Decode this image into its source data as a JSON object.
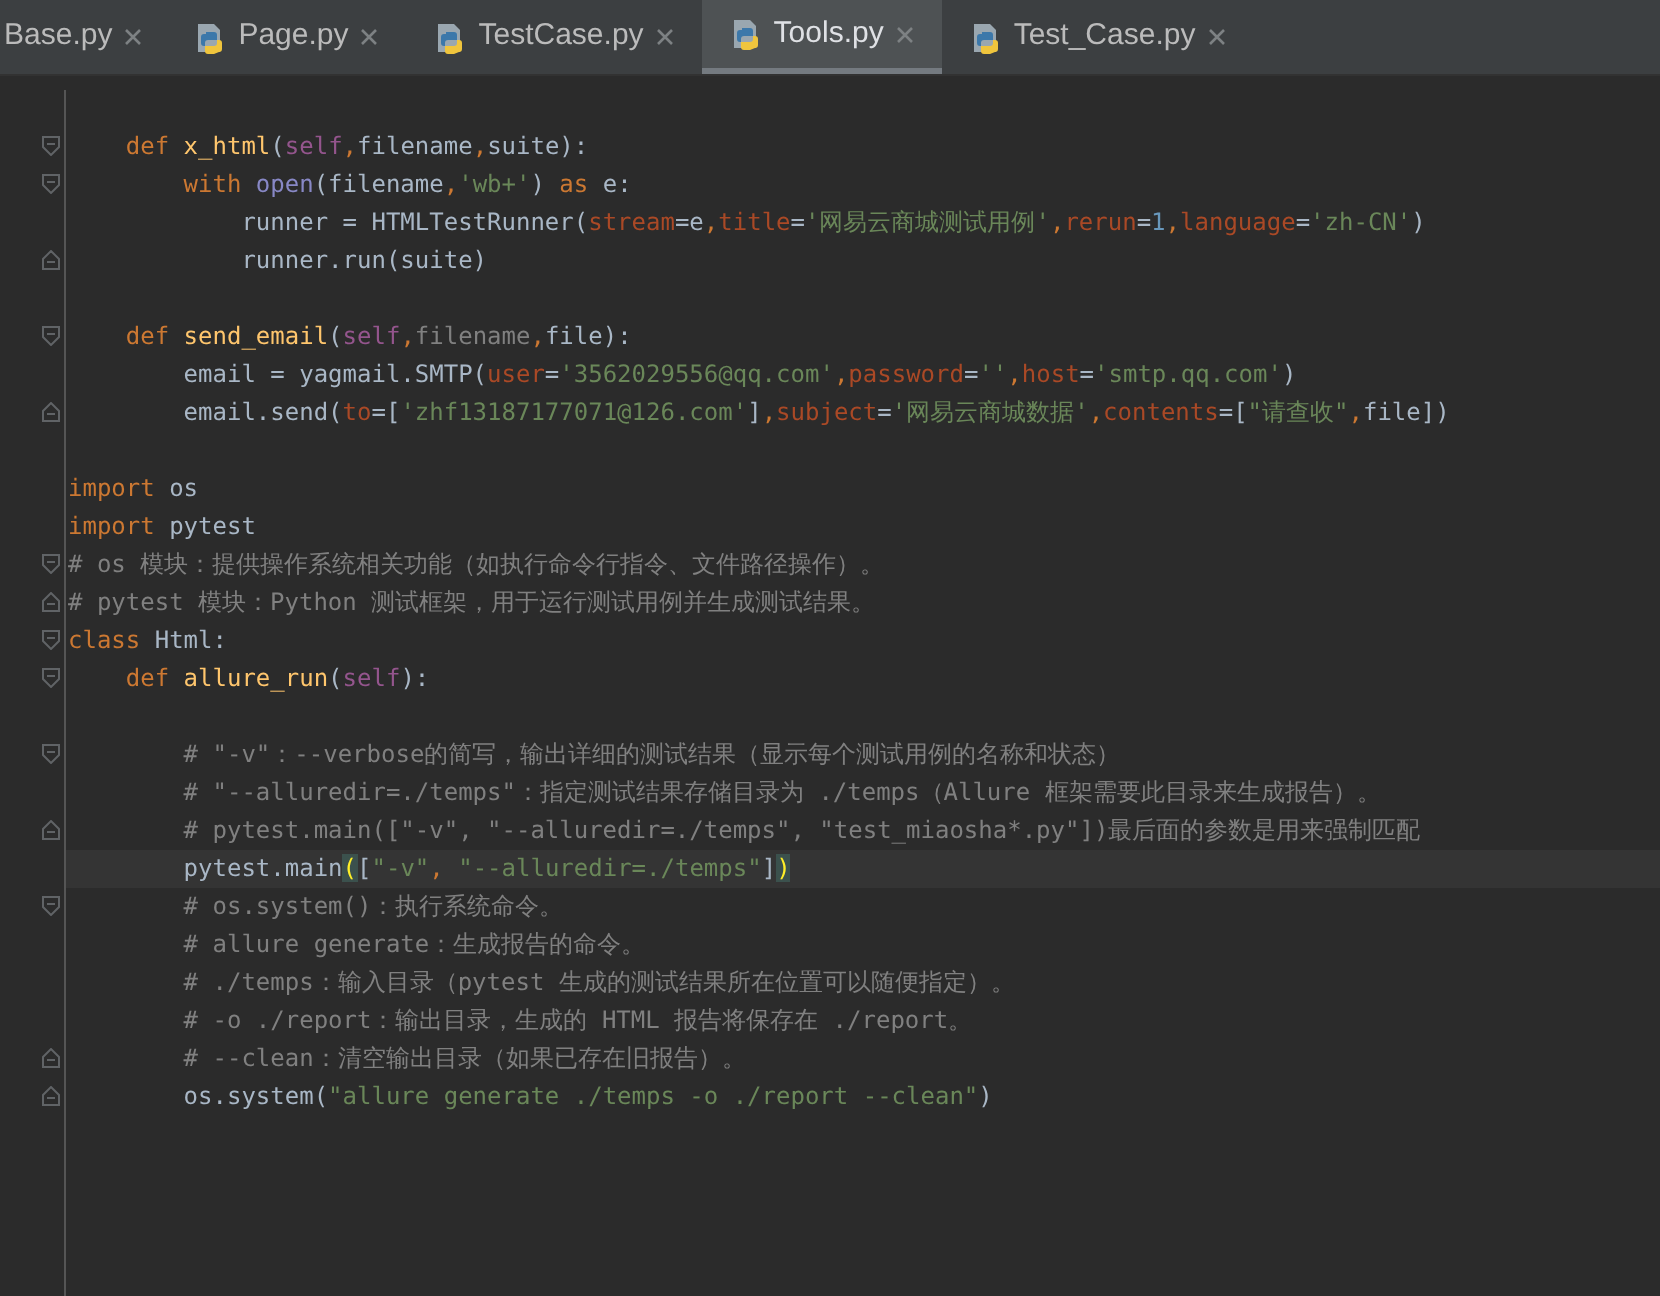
{
  "tabs": [
    {
      "label": "Base.py",
      "selected": false,
      "icon": false
    },
    {
      "label": "Page.py",
      "selected": false,
      "icon": true
    },
    {
      "label": "TestCase.py",
      "selected": false,
      "icon": true
    },
    {
      "label": "Tools.py",
      "selected": true,
      "icon": true
    },
    {
      "label": "Test_Case.py",
      "selected": false,
      "icon": true
    }
  ],
  "code_lines": [
    {
      "kind": "blank"
    },
    {
      "kind": "code",
      "fold_start": true,
      "tokens": [
        {
          "kind": "keyword",
          "text": "    def "
        },
        {
          "kind": "function",
          "text": "x_html"
        },
        {
          "kind": "plain",
          "text": "("
        },
        {
          "kind": "self",
          "text": "self"
        },
        {
          "kind": "keyword",
          "text": ","
        },
        {
          "kind": "plain",
          "text": "filename"
        },
        {
          "kind": "keyword",
          "text": ","
        },
        {
          "kind": "plain",
          "text": "suite):"
        }
      ]
    },
    {
      "kind": "code",
      "fold_start": true,
      "tokens": [
        {
          "kind": "keyword",
          "text": "        with "
        },
        {
          "kind": "builtin",
          "text": "open"
        },
        {
          "kind": "plain",
          "text": "(filename"
        },
        {
          "kind": "keyword",
          "text": ","
        },
        {
          "kind": "string",
          "text": "'wb+'"
        },
        {
          "kind": "plain",
          "text": ") "
        },
        {
          "kind": "keyword",
          "text": "as "
        },
        {
          "kind": "plain",
          "text": "e:"
        }
      ]
    },
    {
      "kind": "code",
      "tokens": [
        {
          "kind": "plain",
          "text": "            runner = HTMLTestRunner("
        },
        {
          "kind": "param",
          "text": "stream"
        },
        {
          "kind": "plain",
          "text": "=e"
        },
        {
          "kind": "keyword",
          "text": ","
        },
        {
          "kind": "param",
          "text": "title"
        },
        {
          "kind": "plain",
          "text": "="
        },
        {
          "kind": "string",
          "text": "'网易云商城测试用例'"
        },
        {
          "kind": "keyword",
          "text": ","
        },
        {
          "kind": "param",
          "text": "rerun"
        },
        {
          "kind": "plain",
          "text": "="
        },
        {
          "kind": "number",
          "text": "1"
        },
        {
          "kind": "keyword",
          "text": ","
        },
        {
          "kind": "param",
          "text": "language"
        },
        {
          "kind": "plain",
          "text": "="
        },
        {
          "kind": "string",
          "text": "'zh-CN'"
        },
        {
          "kind": "plain",
          "text": ")"
        }
      ]
    },
    {
      "kind": "code",
      "fold_end": true,
      "tokens": [
        {
          "kind": "plain",
          "text": "            runner.run(suite)"
        }
      ]
    },
    {
      "kind": "blank"
    },
    {
      "kind": "code",
      "fold_start": true,
      "tokens": [
        {
          "kind": "keyword",
          "text": "    def "
        },
        {
          "kind": "function",
          "text": "send_email"
        },
        {
          "kind": "plain",
          "text": "("
        },
        {
          "kind": "self",
          "text": "self"
        },
        {
          "kind": "keyword",
          "text": ","
        },
        {
          "kind": "comment",
          "text": "filename"
        },
        {
          "kind": "keyword",
          "text": ","
        },
        {
          "kind": "plain",
          "text": "file):"
        }
      ]
    },
    {
      "kind": "code",
      "tokens": [
        {
          "kind": "plain",
          "text": "        email = yagmail.SMTP("
        },
        {
          "kind": "param",
          "text": "user"
        },
        {
          "kind": "plain",
          "text": "="
        },
        {
          "kind": "string",
          "text": "'3562029556@qq.com'"
        },
        {
          "kind": "keyword",
          "text": ","
        },
        {
          "kind": "param",
          "text": "password"
        },
        {
          "kind": "plain",
          "text": "="
        },
        {
          "kind": "string",
          "text": "''"
        },
        {
          "kind": "keyword",
          "text": ","
        },
        {
          "kind": "param",
          "text": "host"
        },
        {
          "kind": "plain",
          "text": "="
        },
        {
          "kind": "string",
          "text": "'smtp.qq.com'"
        },
        {
          "kind": "plain",
          "text": ")"
        }
      ]
    },
    {
      "kind": "code",
      "fold_end": true,
      "tokens": [
        {
          "kind": "plain",
          "text": "        email.send("
        },
        {
          "kind": "param",
          "text": "to"
        },
        {
          "kind": "plain",
          "text": "=["
        },
        {
          "kind": "string",
          "text": "'zhf13187177071@126.com'"
        },
        {
          "kind": "plain",
          "text": "]"
        },
        {
          "kind": "keyword",
          "text": ","
        },
        {
          "kind": "param",
          "text": "subject"
        },
        {
          "kind": "plain",
          "text": "="
        },
        {
          "kind": "string",
          "text": "'网易云商城数据'"
        },
        {
          "kind": "keyword",
          "text": ","
        },
        {
          "kind": "param",
          "text": "contents"
        },
        {
          "kind": "plain",
          "text": "=["
        },
        {
          "kind": "string",
          "text": "\"请查收\""
        },
        {
          "kind": "keyword",
          "text": ","
        },
        {
          "kind": "plain",
          "text": "file])"
        }
      ]
    },
    {
      "kind": "blank"
    },
    {
      "kind": "code",
      "tokens": [
        {
          "kind": "keyword",
          "text": "import "
        },
        {
          "kind": "plain",
          "text": "os"
        }
      ]
    },
    {
      "kind": "code",
      "tokens": [
        {
          "kind": "keyword",
          "text": "import "
        },
        {
          "kind": "plain",
          "text": "pytest"
        }
      ]
    },
    {
      "kind": "code",
      "fold_start": true,
      "tokens": [
        {
          "kind": "comment",
          "text": "# os 模块：提供操作系统相关功能（如执行命令行指令、文件路径操作）。"
        }
      ]
    },
    {
      "kind": "code",
      "fold_end": true,
      "tokens": [
        {
          "kind": "comment",
          "text": "# pytest 模块：Python 测试框架，用于运行测试用例并生成测试结果。"
        }
      ]
    },
    {
      "kind": "code",
      "fold_start": true,
      "tokens": [
        {
          "kind": "keyword",
          "text": "class "
        },
        {
          "kind": "plain",
          "text": "Html:"
        }
      ]
    },
    {
      "kind": "code",
      "fold_start": true,
      "tokens": [
        {
          "kind": "keyword",
          "text": "    def "
        },
        {
          "kind": "function",
          "text": "allure_run"
        },
        {
          "kind": "plain",
          "text": "("
        },
        {
          "kind": "self",
          "text": "self"
        },
        {
          "kind": "plain",
          "text": "):"
        }
      ]
    },
    {
      "kind": "blank"
    },
    {
      "kind": "code",
      "fold_start": true,
      "tokens": [
        {
          "kind": "comment",
          "text": "        # \"-v\"：--verbose的简写，输出详细的测试结果（显示每个测试用例的名称和状态）"
        }
      ]
    },
    {
      "kind": "code",
      "tokens": [
        {
          "kind": "comment",
          "text": "        # \"--alluredir=./temps\"：指定测试结果存储目录为 ./temps（Allure 框架需要此目录来生成报告）。"
        }
      ]
    },
    {
      "kind": "code",
      "fold_end": true,
      "tokens": [
        {
          "kind": "comment",
          "text": "        # pytest.main([\"-v\", \"--alluredir=./temps\", \"test_miaosha*.py\"])最后面的参数是用来强制匹配"
        }
      ]
    },
    {
      "kind": "code",
      "current": true,
      "tokens": [
        {
          "kind": "plain",
          "text": "        pytest.main"
        },
        {
          "kind": "bracket",
          "text": "("
        },
        {
          "kind": "plain",
          "text": "["
        },
        {
          "kind": "string",
          "text": "\"-v\""
        },
        {
          "kind": "keyword",
          "text": ", "
        },
        {
          "kind": "string",
          "text": "\"--alluredir=./temps\""
        },
        {
          "kind": "plain",
          "text": "]"
        },
        {
          "kind": "bracket",
          "text": ")"
        }
      ]
    },
    {
      "kind": "code",
      "fold_start": true,
      "tokens": [
        {
          "kind": "comment",
          "text": "        # os.system()：执行系统命令。"
        }
      ]
    },
    {
      "kind": "code",
      "tokens": [
        {
          "kind": "comment",
          "text": "        # allure generate：生成报告的命令。"
        }
      ]
    },
    {
      "kind": "code",
      "tokens": [
        {
          "kind": "comment",
          "text": "        # ./temps：输入目录（pytest 生成的测试结果所在位置可以随便指定）。"
        }
      ]
    },
    {
      "kind": "code",
      "tokens": [
        {
          "kind": "comment",
          "text": "        # -o ./report：输出目录，生成的 HTML 报告将保存在 ./report。"
        }
      ]
    },
    {
      "kind": "code",
      "fold_end": true,
      "tokens": [
        {
          "kind": "comment",
          "text": "        # --clean：清空输出目录（如果已存在旧报告）。"
        }
      ]
    },
    {
      "kind": "code",
      "fold_end": true,
      "tokens": [
        {
          "kind": "plain",
          "text": "        os.system("
        },
        {
          "kind": "string",
          "text": "\"allure generate ./temps -o ./report --clean\""
        },
        {
          "kind": "plain",
          "text": ")"
        }
      ]
    }
  ]
}
